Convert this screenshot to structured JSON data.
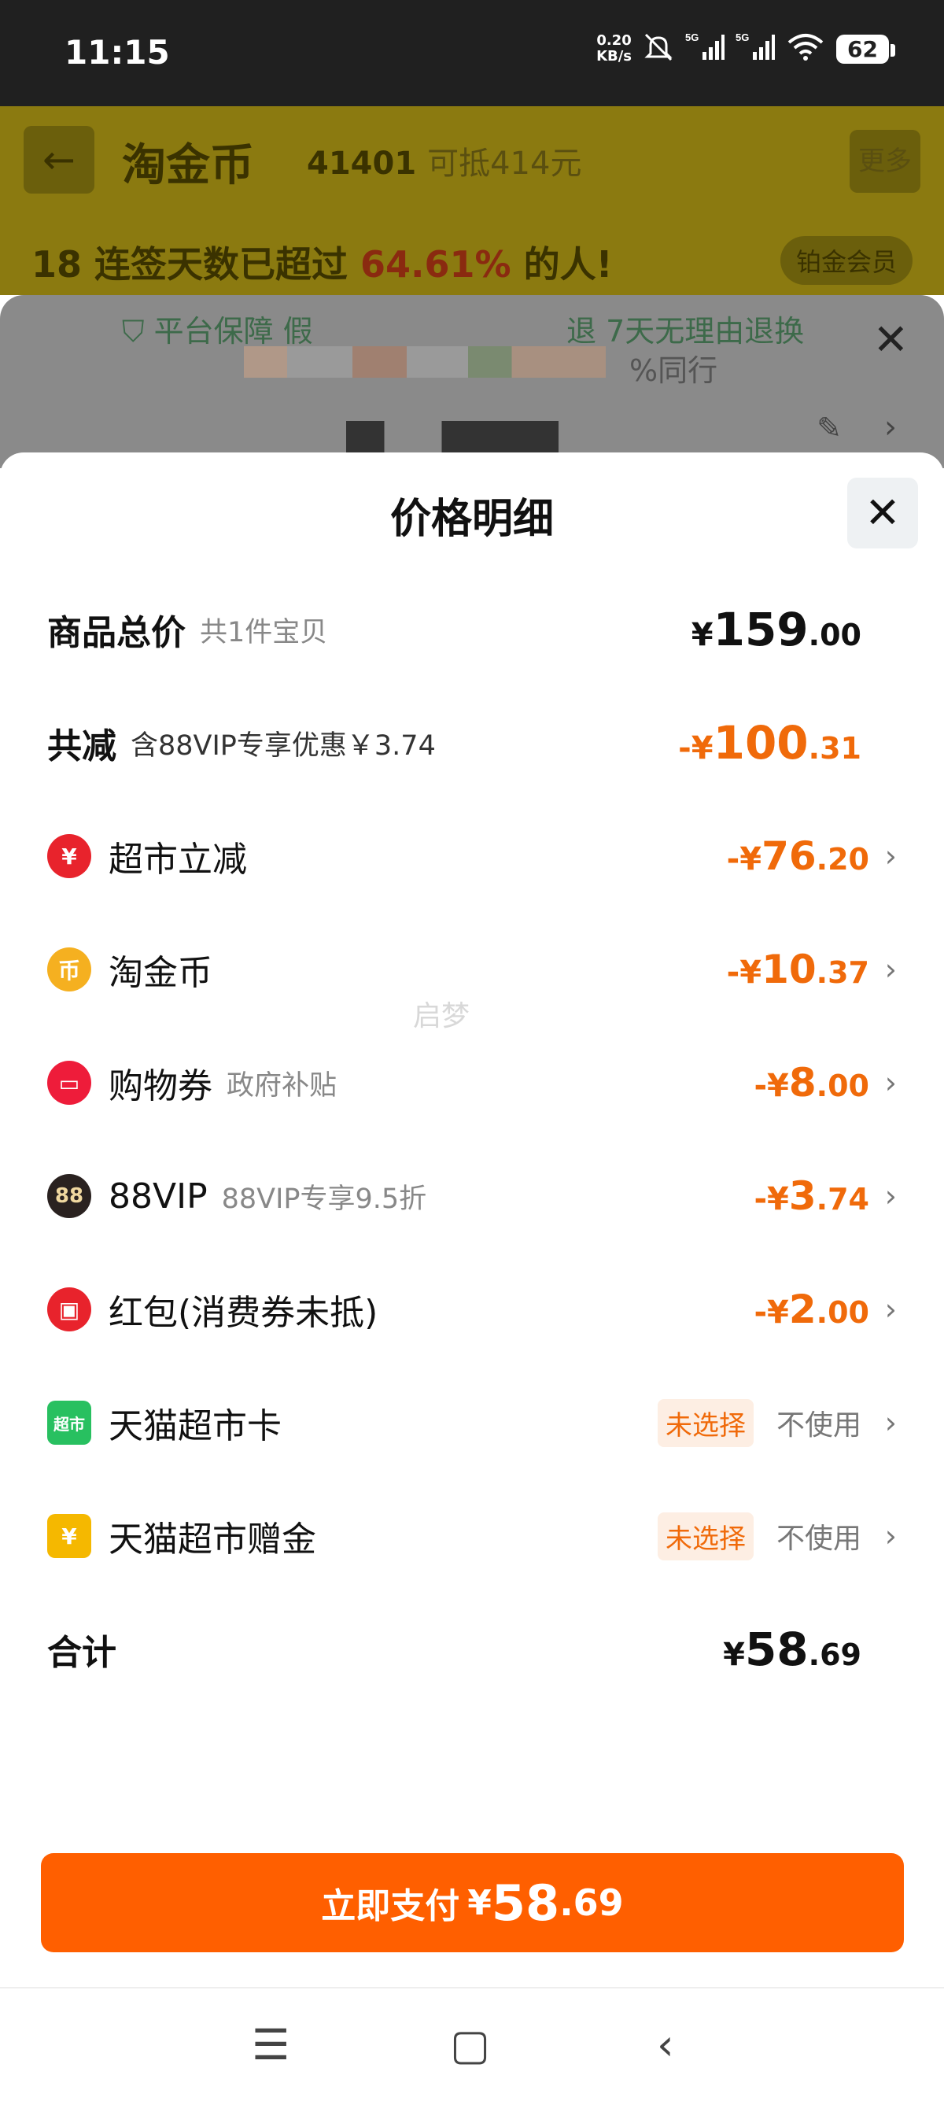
{
  "status_bar": {
    "time": "11:15",
    "net_speed": "0.20",
    "net_unit": "KB/s",
    "sim1": "5G",
    "sim2": "5G",
    "battery": "62"
  },
  "background_page": {
    "title": "淘金币",
    "coins": "41401",
    "coins_sub": "可抵414元",
    "more": "更多",
    "sign_prefix": "连签天数已超过",
    "sign_pct": "64.61%",
    "sign_suffix": "的人!",
    "calendar_day": "18",
    "member": "铂金会员",
    "guarantee": "平台保障",
    "guarantee_fragment": "假",
    "return_policy": "7天无理由退换",
    "return_prefix": "退",
    "same_line": "%同行"
  },
  "sheet": {
    "title": "价格明细",
    "total_row": {
      "label": "商品总价",
      "sub": "共1件宝贝",
      "currency": "¥",
      "int": "159",
      "dec": ".00"
    },
    "discount_row": {
      "label": "共减",
      "sub": "含88VIP专享优惠￥3.74",
      "currency": "-¥",
      "int": "100",
      "dec": ".31"
    },
    "items": [
      {
        "icon": "supermarket-discount-icon",
        "icon_glyph": "¥",
        "label": "超市立减",
        "sub": "",
        "currency": "-¥",
        "int": "76",
        "dec": ".20"
      },
      {
        "icon": "gold-coin-icon",
        "icon_glyph": "币",
        "label": "淘金币",
        "sub": "",
        "currency": "-¥",
        "int": "10",
        "dec": ".37"
      },
      {
        "icon": "coupon-icon",
        "icon_glyph": "▭",
        "label": "购物券",
        "sub": "政府补贴",
        "currency": "-¥",
        "int": "8",
        "dec": ".00"
      },
      {
        "icon": "vip88-icon",
        "icon_glyph": "88",
        "label": "88VIP",
        "sub": "88VIP专享9.5折",
        "currency": "-¥",
        "int": "3",
        "dec": ".74"
      },
      {
        "icon": "red-packet-icon",
        "icon_glyph": "▣",
        "label": "红包(消费券未抵)",
        "sub": "",
        "currency": "-¥",
        "int": "2",
        "dec": ".00"
      }
    ],
    "cards": [
      {
        "icon": "tmall-supermarket-card-icon",
        "icon_glyph": "超市",
        "label": "天猫超市卡",
        "status": "未选择",
        "action": "不使用"
      },
      {
        "icon": "tmall-gift-money-icon",
        "icon_glyph": "¥",
        "label": "天猫超市赠金",
        "status": "未选择",
        "action": "不使用"
      }
    ],
    "sum_row": {
      "label": "合计",
      "currency": "¥",
      "int": "58",
      "dec": ".69"
    },
    "watermark": "启梦",
    "pay_button": {
      "label": "立即支付",
      "currency": "¥",
      "int": "58",
      "dec": ".69"
    }
  },
  "colors": {
    "accent": "#ff5f00",
    "discount": "#f06a0a",
    "statusbar": "#202020"
  }
}
